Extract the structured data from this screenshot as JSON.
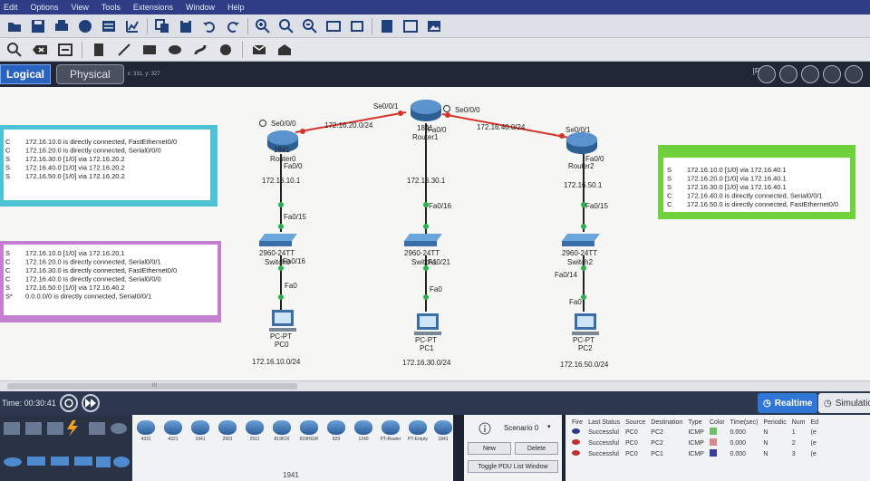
{
  "menu": [
    "Edit",
    "Options",
    "View",
    "Tools",
    "Extensions",
    "Window",
    "Help"
  ],
  "mode_tabs": {
    "logical": "Logical",
    "physical": "Physical",
    "coords": "x: 331, y: 327"
  },
  "root_label": "[Root]",
  "topology": {
    "routers": [
      {
        "name": "Router0",
        "label_parts": [
          "1841",
          "Router0"
        ],
        "ports": [
          "Se0/0/0",
          "Fa0/0"
        ]
      },
      {
        "name": "Router1",
        "label_parts": [
          "1841",
          "Router1"
        ],
        "ports": [
          "Se0/0/1",
          "Se0/0/0",
          "Fa0/0"
        ]
      },
      {
        "name": "Router2",
        "label_parts": [
          "Se0/0/1",
          "Router2"
        ],
        "ports": [
          "Fa0/0"
        ]
      }
    ],
    "links": [
      {
        "label": "172.16.20.0/24"
      },
      {
        "label": "172.16.40.0/24"
      }
    ],
    "gateways": [
      "172.16.10.1",
      "172.16.30.1",
      "172.16.50.1"
    ],
    "switches": [
      {
        "model": "2960-24TT",
        "name": "Switch0",
        "up_port": "Fa0/15",
        "down_port": "Fa0/16"
      },
      {
        "model": "2960-24TT",
        "name": "Switch1",
        "up_port": "Fa0/16",
        "down_port": "Fa0/21"
      },
      {
        "model": "2960-24TT",
        "name": "Switch2",
        "up_port": "Fa0/15",
        "down_port": "Fa0/14"
      }
    ],
    "pcs": [
      {
        "type": "PC-PT",
        "name": "PC0",
        "port": "Fa0",
        "network": "172.16.10.0/24"
      },
      {
        "type": "PC-PT",
        "name": "PC1",
        "port": "Fa0",
        "network": "172.16.30.0/24"
      },
      {
        "type": "PC-PT",
        "name": "PC2",
        "port": "Fa0",
        "network": "172.16.50.0/24"
      }
    ]
  },
  "notes": [
    {
      "color": "#4fc3d6",
      "lines": [
        [
          "C",
          "172.16.10.0 is directly connected, FastEthernet0/0"
        ],
        [
          "C",
          "172.16.20.0 is directly connected, Serial0/0/0"
        ],
        [
          "S",
          "172.16.30.0 [1/0] via 172.16.20.2"
        ],
        [
          "S",
          "172.16.40.0 [1/0] via 172.16.20.2"
        ],
        [
          "S",
          "172.16.50.0 [1/0] via 172.16.20.2"
        ]
      ]
    },
    {
      "color": "#c47fd0",
      "lines": [
        [
          "S",
          "172.16.10.0 [1/0] via 172.16.20.1"
        ],
        [
          "C",
          "172.16.20.0 is directly connected, Serial0/0/1"
        ],
        [
          "C",
          "172.16.30.0 is directly connected, FastEthernet0/0"
        ],
        [
          "C",
          "172.16.40.0 is directly connected, Serial0/0/0"
        ],
        [
          "S",
          "172.16.50.0 [1/0] via 172.16.40.2"
        ],
        [
          "S*",
          "0.0.0.0/0 is directly connected, Serial0/0/1"
        ]
      ]
    },
    {
      "color": "#6fd23c",
      "lines": [
        [
          "S",
          "172.16.10.0 [1/0] via 172.16.40.1"
        ],
        [
          "S",
          "172.16.20.0 [1/0] via 172.16.40.1"
        ],
        [
          "S",
          "172.16.30.0 [1/0] via 172.16.40.1"
        ],
        [
          "C",
          "172.16.40.0 is directly connected, Serial0/0/1"
        ],
        [
          "C",
          "172.16.50.0 is directly connected, FastEthernet0/0"
        ]
      ]
    }
  ],
  "scroll_grip": "III",
  "time": "Time: 00:30:41",
  "realtime": "Realtime",
  "simulation": "Simulation",
  "device_models": [
    "4331",
    "4321",
    "1941",
    "2901",
    "2911",
    "819IOX",
    "819HGW",
    "829",
    "1240",
    "PT-Router",
    "PT-Empty",
    "1841"
  ],
  "selected_device": "1941",
  "scenario": "Scenario 0",
  "buttons": {
    "new": "New",
    "delete": "Delete",
    "toggle": "Toggle PDU List Window"
  },
  "events": {
    "headers": [
      "Fire",
      "Last Status",
      "Source",
      "Destination",
      "Type",
      "Color",
      "Time(sec)",
      "Periodic",
      "Num",
      "Ed"
    ],
    "rows": [
      {
        "status": "Successful",
        "source": "PC0",
        "destination": "PC2",
        "type": "ICMP",
        "color": "#6fbf6a",
        "time": "0.000",
        "periodic": "N",
        "num": "1",
        "ed": "(e"
      },
      {
        "status": "Successful",
        "source": "PC0",
        "destination": "PC2",
        "type": "ICMP",
        "color": "#d88a8a",
        "time": "0.000",
        "periodic": "N",
        "num": "2",
        "ed": "(e"
      },
      {
        "status": "Successful",
        "source": "PC0",
        "destination": "PC1",
        "type": "ICMP",
        "color": "#3b3fa0",
        "time": "0.000",
        "periodic": "N",
        "num": "3",
        "ed": "(e"
      }
    ]
  }
}
